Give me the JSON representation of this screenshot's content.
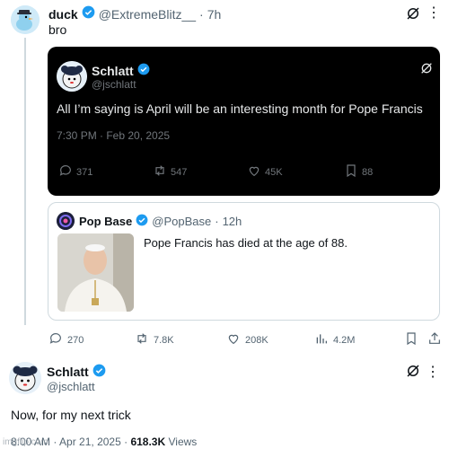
{
  "top_tweet": {
    "display_name": "duck",
    "handle": "@ExtremeBlitz__",
    "separator": "·",
    "time_ago": "7h",
    "text": "bro"
  },
  "embedded_tweet": {
    "display_name": "Schlatt",
    "handle": "@jschlatt",
    "text": "All I’m saying is April will be an interesting month for Pope Francis",
    "timestamp": "7:30 PM · Feb 20, 2025",
    "replies": "371",
    "reposts": "547",
    "likes": "45K",
    "bookmarks": "88"
  },
  "quoted_tweet": {
    "display_name": "Pop Base",
    "handle": "@PopBase",
    "separator": "·",
    "time_ago": "12h",
    "text": "Pope Francis has died at the age of 88."
  },
  "main_metrics": {
    "replies": "270",
    "reposts": "7.8K",
    "likes": "208K",
    "views": "4.2M"
  },
  "bottom_tweet": {
    "display_name": "Schlatt",
    "handle": "@jschlatt",
    "text": "Now, for my next trick",
    "time": "8:00 AM",
    "date": "Apr 21, 2025",
    "separator": "·",
    "views_count": "618.3K",
    "views_label": "Views"
  },
  "watermark": "imgflip.com",
  "colors": {
    "verified": "#1d9bf0",
    "muted": "#536471",
    "dark_bg": "#000000"
  }
}
